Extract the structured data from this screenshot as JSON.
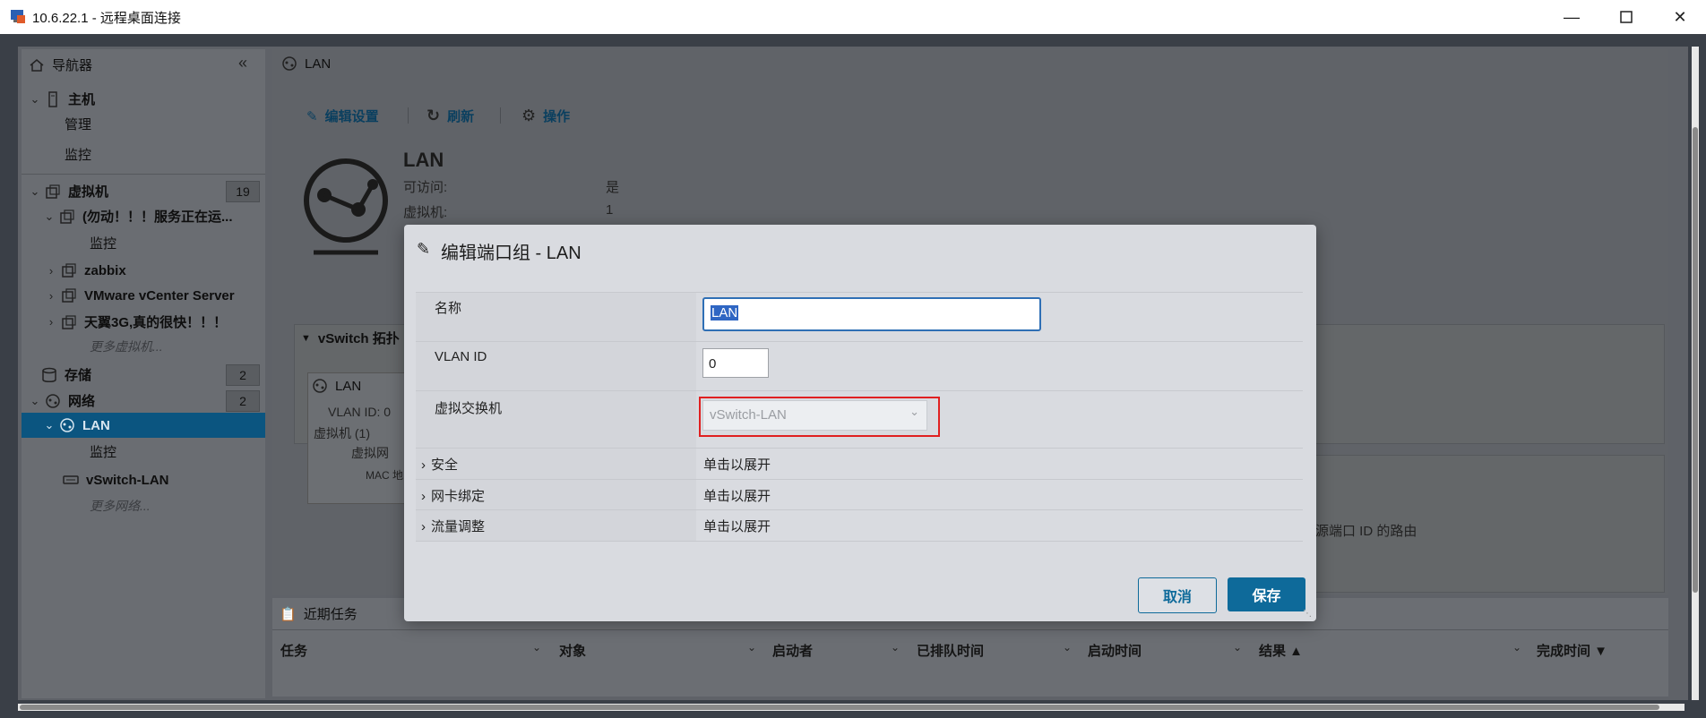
{
  "window": {
    "title": "10.6.22.1 - 远程桌面连接"
  },
  "navigator": {
    "title": "导航器",
    "host": {
      "label": "主机",
      "items": [
        "管理",
        "监控"
      ]
    },
    "vms": {
      "label": "虚拟机",
      "count": "19",
      "items": [
        {
          "label": "(勿动！！！服务正在运..."
        },
        {
          "label": "监控"
        },
        {
          "label": "zabbix"
        },
        {
          "label": "VMware vCenter Server"
        },
        {
          "label": "天翼3G,真的很快！！！"
        }
      ],
      "more": "更多虚拟机..."
    },
    "storage": {
      "label": "存储",
      "count": "2"
    },
    "network": {
      "label": "网络",
      "count": "2",
      "selected": "LAN",
      "sub": "监控",
      "vswitch": "vSwitch-LAN",
      "more": "更多网络..."
    }
  },
  "main": {
    "header": "LAN",
    "toolbar": {
      "edit": "编辑设置",
      "refresh": "刷新",
      "actions": "操作"
    },
    "info": {
      "name": "LAN",
      "rows": [
        {
          "k": "可访问:",
          "v": "是"
        },
        {
          "k": "虚拟机:",
          "v": "1"
        }
      ]
    },
    "topology": {
      "title": "vSwitch 拓扑",
      "card_title": "LAN",
      "vlan": "VLAN ID: 0",
      "vms": "虚拟机 (1)",
      "vm_nic": "虚拟网",
      "mac": "MAC 地"
    },
    "right_hint": "源端口 ID 的路由"
  },
  "tasks": {
    "title": "近期任务",
    "columns": [
      "任务",
      "对象",
      "启动者",
      "已排队时间",
      "启动时间",
      "结果 ▲",
      "完成时间 ▼"
    ]
  },
  "dialog": {
    "title": "编辑端口组 - LAN",
    "fields": {
      "name_label": "名称",
      "name_value": "LAN",
      "vlan_label": "VLAN ID",
      "vlan_value": "0",
      "vswitch_label": "虚拟交换机",
      "vswitch_value": "vSwitch-LAN"
    },
    "sections": [
      {
        "label": "安全",
        "value": "单击以展开"
      },
      {
        "label": "网卡绑定",
        "value": "单击以展开"
      },
      {
        "label": "流量调整",
        "value": "单击以展开"
      }
    ],
    "cancel": "取消",
    "save": "保存"
  },
  "colors": {
    "accent": "#0e6a9a",
    "selected_nav": "#0b5580",
    "highlight_box": "#e02020"
  }
}
